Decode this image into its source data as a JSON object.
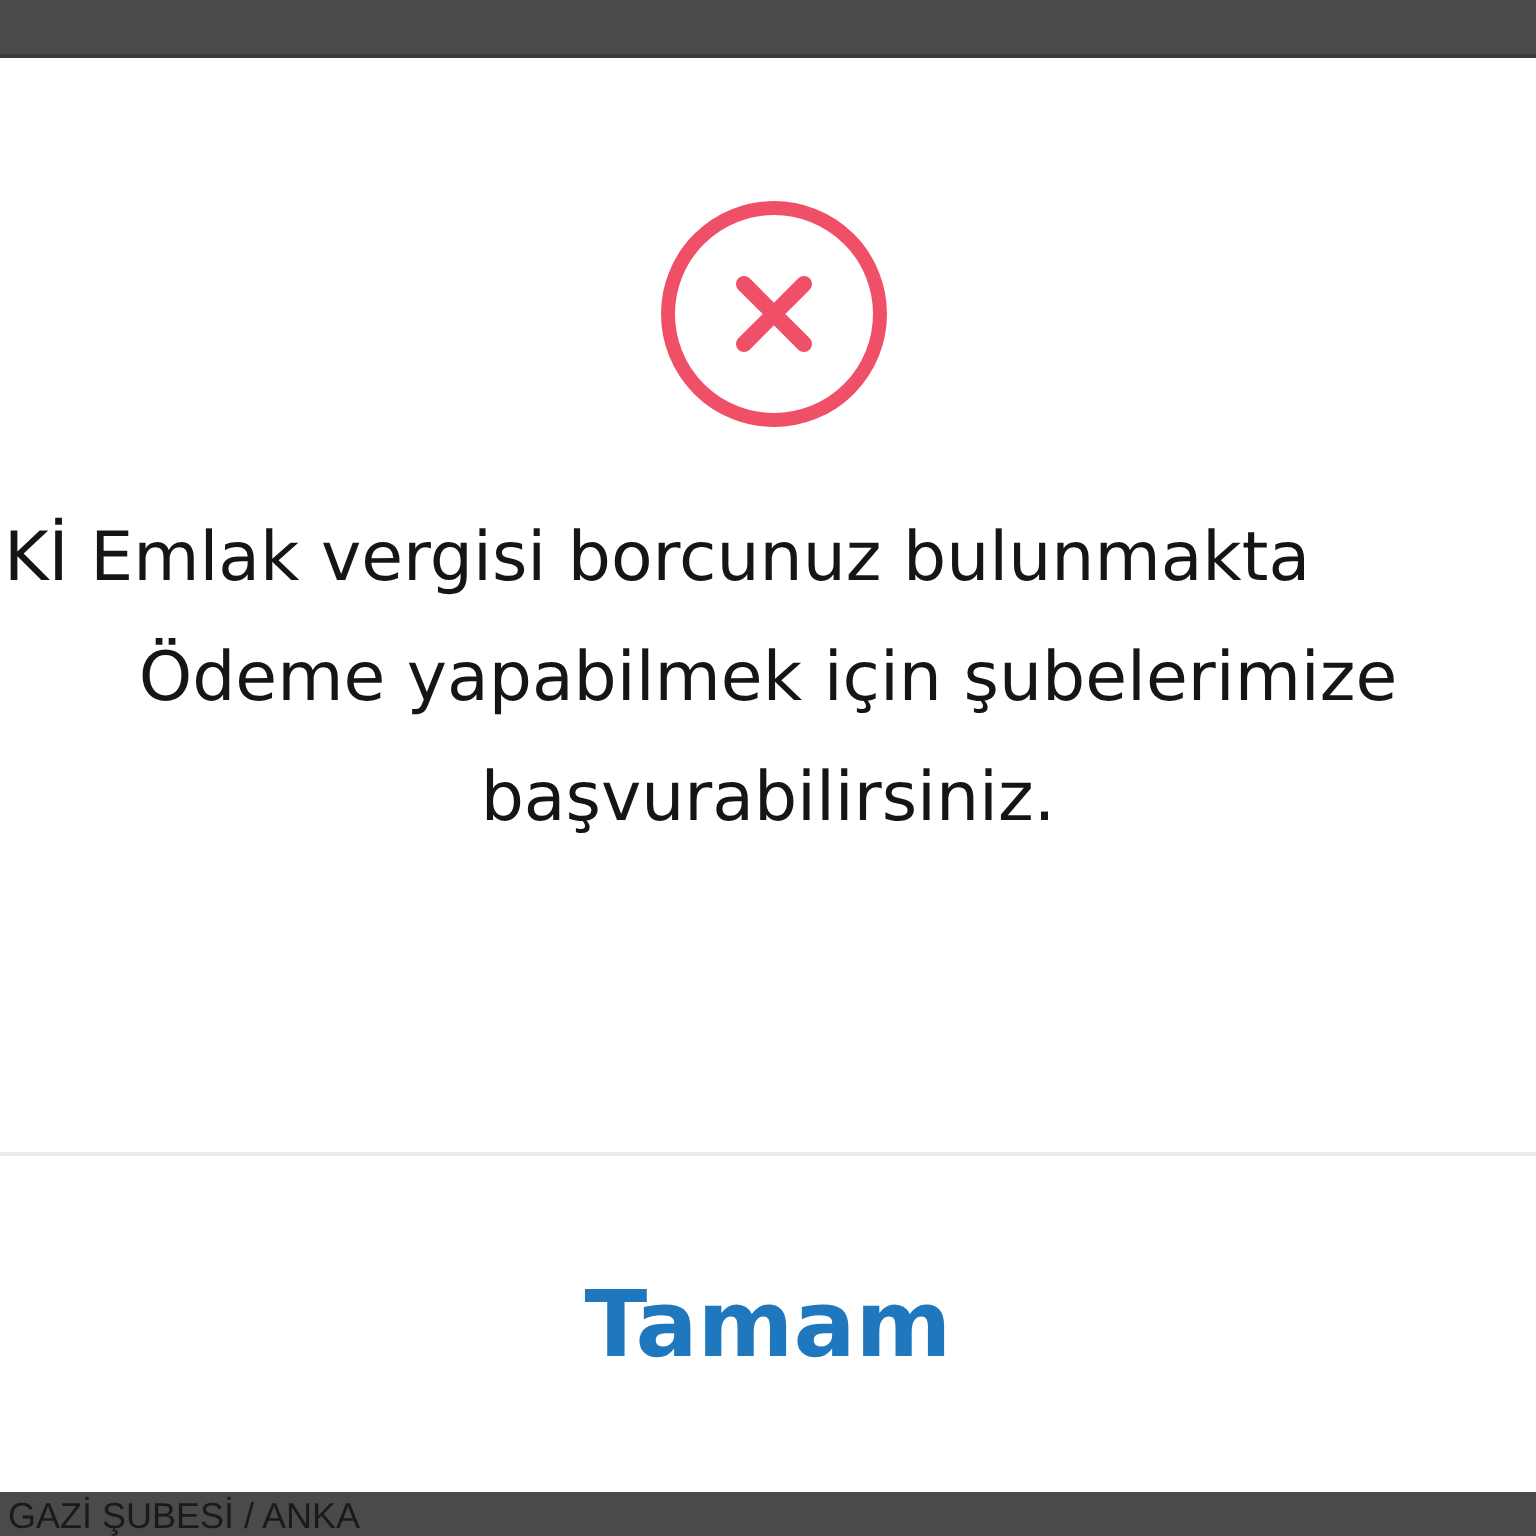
{
  "dialog": {
    "icon": {
      "kind": "error"
    },
    "message_lines": [
      "Kİ Emlak vergisi borcunuz bulunmakta",
      "Ödeme yapabilmek için şubelerimize",
      "başvurabilirsiniz."
    ],
    "button": "Tamam"
  },
  "background": {
    "text": "GAZİ ŞUBESİ / ANKA"
  }
}
